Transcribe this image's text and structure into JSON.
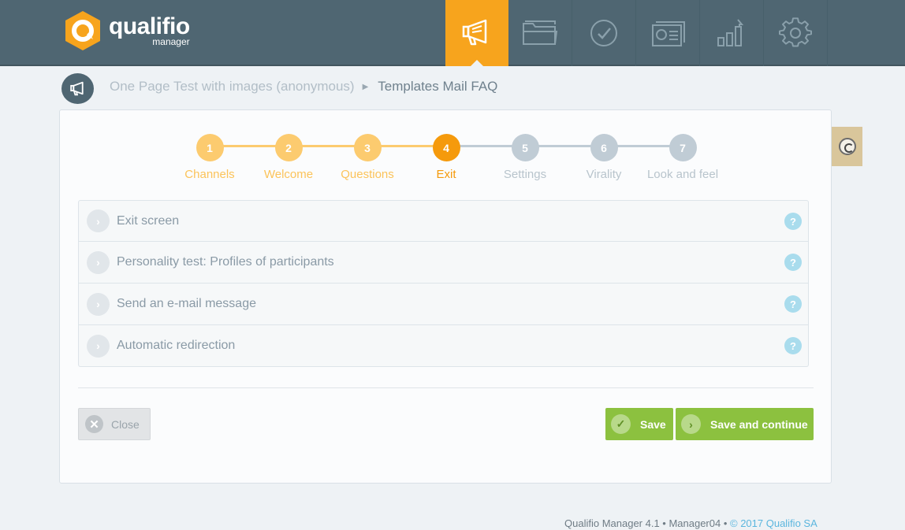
{
  "app": {
    "logo_name": "qualifio",
    "logo_sub": "manager"
  },
  "nav": [
    {
      "name": "megaphone-icon",
      "active": true
    },
    {
      "name": "folder-icon",
      "active": false
    },
    {
      "name": "check-circle-icon",
      "active": false
    },
    {
      "name": "contact-cards-icon",
      "active": false
    },
    {
      "name": "bar-chart-icon",
      "active": false
    },
    {
      "name": "gear-icon",
      "active": false
    }
  ],
  "breadcrumb": {
    "parent": "One Page Test with images (anonymous)",
    "current": "Templates Mail FAQ"
  },
  "stepper": {
    "steps": [
      {
        "num": "1",
        "label": "Channels",
        "state": "done"
      },
      {
        "num": "2",
        "label": "Welcome",
        "state": "done"
      },
      {
        "num": "3",
        "label": "Questions",
        "state": "done"
      },
      {
        "num": "4",
        "label": "Exit",
        "state": "current"
      },
      {
        "num": "5",
        "label": "Settings",
        "state": "todo"
      },
      {
        "num": "6",
        "label": "Virality",
        "state": "todo"
      },
      {
        "num": "7",
        "label": "Look and feel",
        "state": "todo"
      }
    ]
  },
  "sections": [
    {
      "label": "Exit screen",
      "help": "?"
    },
    {
      "label": "Personality test: Profiles of participants",
      "help": "?"
    },
    {
      "label": "Send an e-mail message",
      "help": "?"
    },
    {
      "label": "Automatic redirection",
      "help": "?"
    }
  ],
  "buttons": {
    "close": "Close",
    "save": "Save",
    "save_continue": "Save and continue"
  },
  "footer": {
    "text": "Qualifio Manager 4.1 • Manager04 • ",
    "copyright": "© 2017 Qualifio SA"
  },
  "colors": {
    "topbar": "#4f6672",
    "accent": "#f7a41d",
    "green": "#8cc13f"
  }
}
